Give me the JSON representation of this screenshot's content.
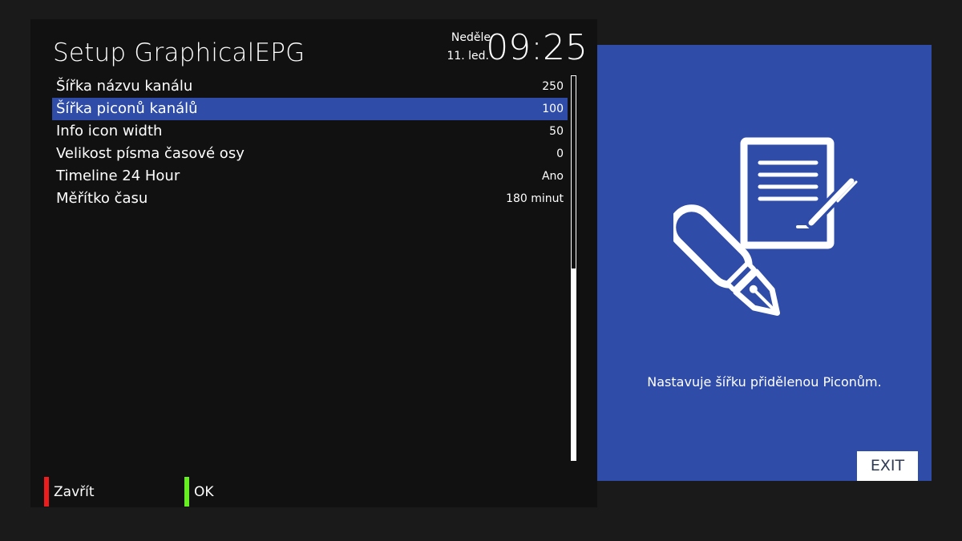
{
  "header": {
    "title": "Setup GraphicalEPG",
    "day_name": "Neděle",
    "date": "11. led.",
    "time": "09:25"
  },
  "settings": [
    {
      "label": "Šířka názvu kanálu",
      "value": "250",
      "selected": false
    },
    {
      "label": "Šířka piconů kanálů",
      "value": "100",
      "selected": true
    },
    {
      "label": "Info icon width",
      "value": "50",
      "selected": false
    },
    {
      "label": "Velikost písma časové osy",
      "value": "0",
      "selected": false
    },
    {
      "label": "Timeline 24 Hour",
      "value": "Ano",
      "selected": false
    },
    {
      "label": "Měřítko času",
      "value": "180 minut",
      "selected": false
    }
  ],
  "footer": {
    "red": {
      "label": "Zavřít",
      "color": "#ee1c1c"
    },
    "green": {
      "label": "OK",
      "color": "#66ee22"
    }
  },
  "side": {
    "icon": "document-pen-icon",
    "description": "Nastavuje šířku přidělenou Piconům.",
    "exit_label": "EXIT",
    "background": "#2f4ca8"
  },
  "colors": {
    "selection": "#2f4da8",
    "panel": "#111111",
    "background": "#1a1a1a"
  }
}
